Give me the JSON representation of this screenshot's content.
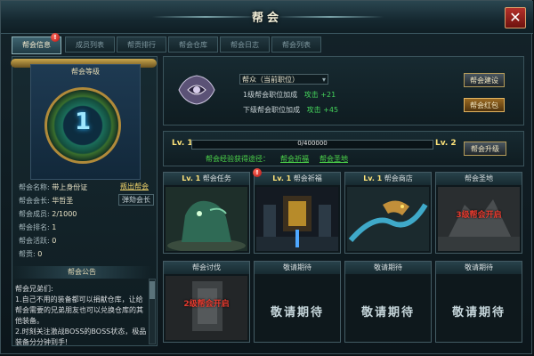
{
  "window": {
    "title": "帮会",
    "close_label": "✕"
  },
  "tabs": [
    {
      "label": "帮会信息",
      "active": true,
      "badge": "!"
    },
    {
      "label": "成员列表"
    },
    {
      "label": "帮贡排行"
    },
    {
      "label": "帮会仓库"
    },
    {
      "label": "帮会日志"
    },
    {
      "label": "帮会列表"
    }
  ],
  "left": {
    "banner_title": "帮会等级",
    "guild_level": "1",
    "info": [
      {
        "label": "帮会名称:",
        "value": "带上身份证"
      },
      {
        "label": "帮会会长:",
        "value": "华哲圣"
      },
      {
        "label": "帮会成员:",
        "value": "2/1000"
      },
      {
        "label": "帮会排名:",
        "value": "1"
      },
      {
        "label": "帮会活跃:",
        "value": "0"
      },
      {
        "label": "帮贡:",
        "value": "0"
      }
    ],
    "leave_link": "叛出帮会",
    "impeach_link": "弹劾会长",
    "notice_title": "帮会公告",
    "notice_lines": [
      "帮会兄弟们:",
      "1.自己不用的装备都可以捐献仓库，让给帮会需要的兄弟朋友也可以兑换仓库的其他装备。",
      "2.时刻关注激战BOSS的BOSS状态，极品装备分分钟到手!"
    ]
  },
  "position": {
    "selected": "帮众（当前职位）",
    "bonus1_label": "1级帮会职位加成",
    "bonus1_value": "攻击 +21",
    "bonus2_label": "下级帮会职位加成",
    "bonus2_value": "攻击 +45",
    "build_button": "帮会建设",
    "redpacket_button": "帮会红包"
  },
  "experience": {
    "current_level": "Lv. 1",
    "next_level": "Lv. 2",
    "text": "0/400000",
    "progress": 0,
    "source_label": "帮会经验获得途径：",
    "source_links": [
      "帮会祈福",
      "帮会圣地"
    ],
    "upgrade_button": "帮会升级"
  },
  "features": [
    {
      "level": "Lv. 1",
      "title": "帮会任务",
      "scene": "statue"
    },
    {
      "level": "Lv. 1",
      "title": "帮会祈福",
      "scene": "shrine",
      "badge": "!"
    },
    {
      "level": "Lv. 1",
      "title": "帮会商店",
      "scene": "dragon"
    },
    {
      "level": "",
      "title": "帮会圣地",
      "scene": "locked",
      "lock_text": "3级帮会开启"
    },
    {
      "level": "",
      "title": "帮会讨伐",
      "scene": "locked2",
      "lock_text": "2级帮会开启"
    },
    {
      "level": "",
      "title": "敬请期待",
      "soon": "敬请期待"
    },
    {
      "level": "",
      "title": "敬请期待",
      "soon": "敬请期待"
    },
    {
      "level": "",
      "title": "敬请期待",
      "soon": "敬请期待"
    }
  ],
  "colors": {
    "accent_gold": "#ffe47a",
    "bonus_green": "#44d35b",
    "lock_red": "#e53b2f"
  }
}
